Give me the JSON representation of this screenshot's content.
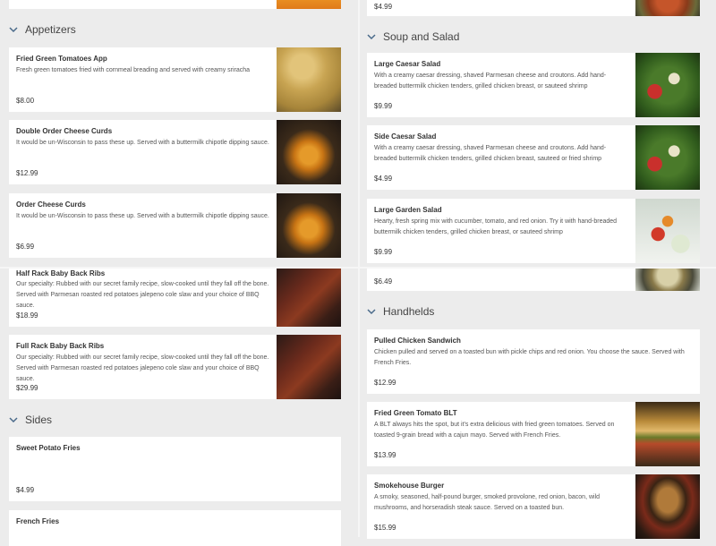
{
  "top_fragments": {
    "right_price": "$4.99"
  },
  "left": {
    "appetizers": {
      "title": "Appetizers",
      "items": [
        {
          "name": "Fried Green Tomatoes App",
          "desc": "Fresh green tomatoes fried with cornmeal breading and served with creamy sriracha",
          "price": "$8.00",
          "image": "fried-green-tomatoes-photo"
        },
        {
          "name": "Double Order Cheese Curds",
          "desc": "It would be un-Wisconsin to pass these up. Served with a buttermilk chipotle dipping sauce.",
          "price": "$12.99",
          "image": "cheese-curds-photo"
        },
        {
          "name": "Order Cheese Curds",
          "desc": "It would be un-Wisconsin to pass these up. Served with a buttermilk chipotle dipping sauce.",
          "price": "$6.99",
          "image": "cheese-curds-photo"
        },
        {
          "name": "Half Rack Baby Back Ribs",
          "desc": "Our specialty: Rubbed with our secret family recipe, slow-cooked until they fall off the bone. Served with Parmesan roasted red potatoes jalepeno cole slaw and your choice of BBQ sauce.",
          "price": "$18.99",
          "image": "ribs-photo"
        },
        {
          "name": "Full Rack Baby Back Ribs",
          "desc": "Our specialty: Rubbed with our secret family recipe, slow-cooked until they fall off the bone. Served with Parmesan roasted red potatoes jalepeno cole slaw and your choice of BBQ sauce.",
          "price": "$29.99",
          "image": "ribs-photo"
        }
      ]
    },
    "sides": {
      "title": "Sides",
      "items": [
        {
          "name": "Sweet Potato Fries",
          "desc": "",
          "price": "$4.99"
        },
        {
          "name": "French Fries",
          "desc": "",
          "price": ""
        }
      ]
    }
  },
  "right": {
    "soup_salad": {
      "title": "Soup and Salad",
      "items": [
        {
          "name": "Large Caesar Salad",
          "desc": "With a creamy caesar dressing, shaved Parmesan cheese and croutons. Add hand-breaded buttermilk chicken tenders, grilled chicken breast, or sauteed  shrimp",
          "price": "$9.99",
          "image": "caesar-salad-photo"
        },
        {
          "name": "Side Caesar Salad",
          "desc": "With a creamy caesar dressing, shaved Parmesan cheese and croutons. Add hand-breaded buttermilk chicken tenders, grilled chicken breast, sauteed or fried shrimp",
          "price": "$4.99",
          "image": "caesar-salad-photo"
        },
        {
          "name": "Large Garden Salad",
          "desc": "Hearty, fresh spring mix with cucumber, tomato, and red onion. Try it with hand-breaded buttermilk chicken tenders, grilled chicken breast, or sauteed shrimp",
          "price": "$9.99",
          "image": "garden-salad-photo"
        },
        {
          "name": "",
          "desc": "",
          "price": "$6.49",
          "image": "soup-bowl-photo"
        }
      ]
    },
    "handhelds": {
      "title": "Handhelds",
      "items": [
        {
          "name": "Pulled Chicken Sandwich",
          "desc": "Chicken pulled and served on a toasted bun with pickle chips and red onion.  You choose the sauce.  Served with French Fries.",
          "price": "$12.99"
        },
        {
          "name": "Fried Green Tomato BLT",
          "desc": "A BLT always hits the spot, but it's extra delicious with fried green tomatoes. Served on toasted 9-grain bread with a cajun mayo.  Served with French Fries.",
          "price": "$13.99",
          "image": "blt-photo"
        },
        {
          "name": "Smokehouse Burger",
          "desc": "A smoky, seasoned, half-pound burger, smoked provolone, red onion, bacon, wild mushrooms, and horseradish steak sauce. Served on a toasted bun.",
          "price": "$15.99",
          "image": "burger-photo"
        }
      ]
    }
  },
  "colors": {
    "background": "#ececec",
    "card": "#ffffff",
    "text": "#333333"
  }
}
